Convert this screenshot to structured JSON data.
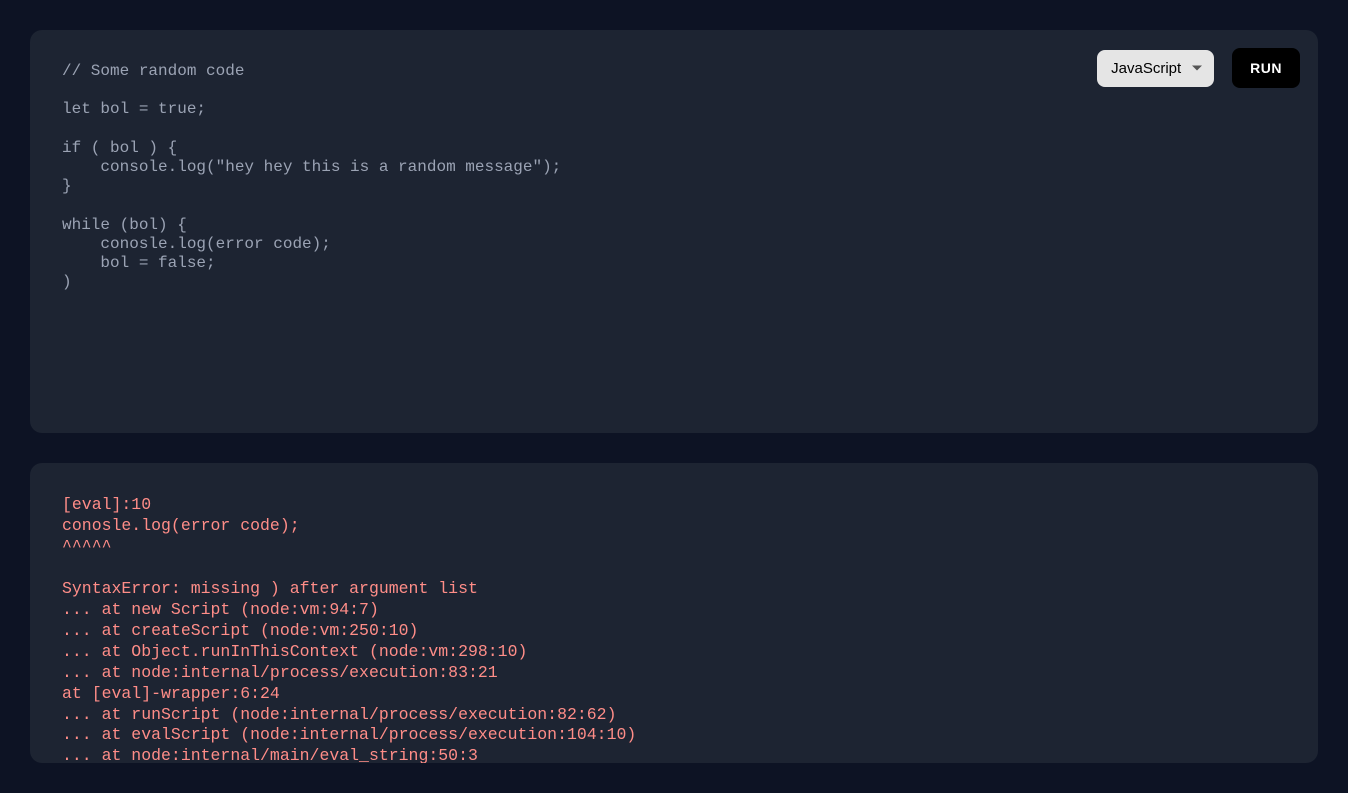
{
  "editor": {
    "code": "// Some random code\n\nlet bol = true;\n\nif ( bol ) {\n    console.log(\"hey hey this is a random message\");\n}\n\nwhile (bol) {\n    conosle.log(error code);\n    bol = false;\n)",
    "language_selected": "JavaScript",
    "run_label": "RUN"
  },
  "output": {
    "text": "[eval]:10\nconosle.log(error code);\n^^^^^\n\nSyntaxError: missing ) after argument list\n... at new Script (node:vm:94:7)\n... at createScript (node:vm:250:10)\n... at Object.runInThisContext (node:vm:298:10)\n... at node:internal/process/execution:83:21\nat [eval]-wrapper:6:24\n... at runScript (node:internal/process/execution:82:62)\n... at evalScript (node:internal/process/execution:104:10)\n... at node:internal/main/eval_string:50:3"
  }
}
